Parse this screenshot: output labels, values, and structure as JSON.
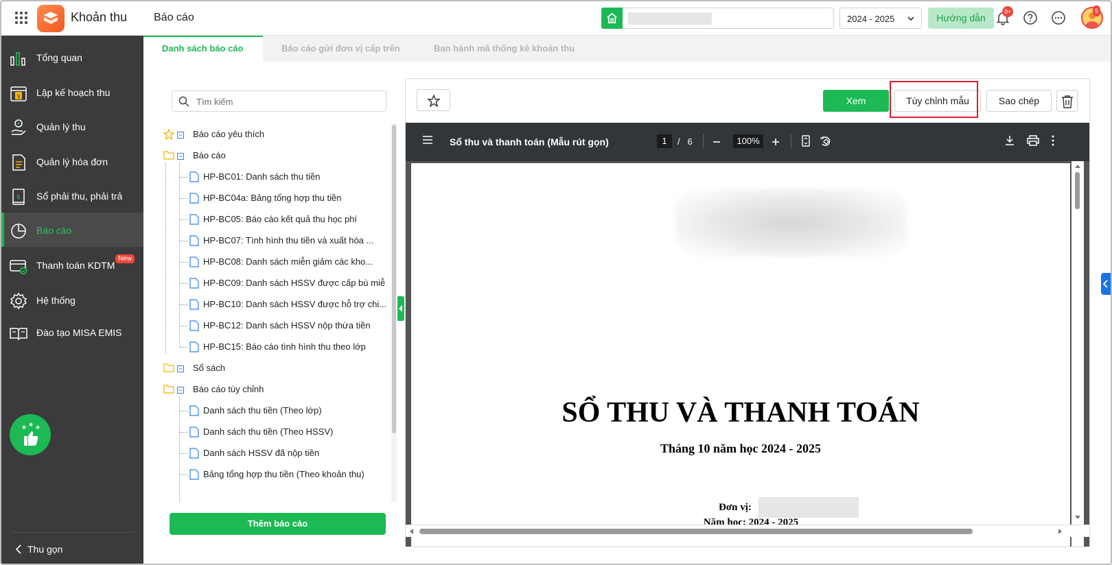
{
  "header": {
    "app_name": "Khoản thu",
    "page_title": "Báo cáo",
    "school_year": "2024 - 2025",
    "guide_label": "Hướng dẫn",
    "notif_badge": "9+",
    "avatar_badge": "5"
  },
  "sidebar": {
    "items": [
      {
        "label": "Tổng quan",
        "icon": "bar-chart-icon"
      },
      {
        "label": "Lập kế hoạch thu",
        "icon": "calendar-money-icon"
      },
      {
        "label": "Quản lý thu",
        "icon": "hand-coin-icon"
      },
      {
        "label": "Quản lý hóa đơn",
        "icon": "invoice-icon"
      },
      {
        "label": "Sổ phải thu, phải trả",
        "icon": "ledger-icon"
      },
      {
        "label": "Báo cáo",
        "icon": "pie-chart-icon"
      },
      {
        "label": "Thanh toán KDTM",
        "icon": "card-payment-icon"
      },
      {
        "label": "Hệ thống",
        "icon": "gear-icon"
      },
      {
        "label": "Đào tạo MISA EMIS",
        "icon": "book-icon"
      }
    ],
    "active_index": 5,
    "new_badge": "New",
    "collapse_label": "Thu gọn"
  },
  "tabs": [
    {
      "label": "Danh sách báo cáo",
      "active": true
    },
    {
      "label": "Báo cáo gửi đơn vị cấp trên",
      "active": false
    },
    {
      "label": "Ban hành mã thống kê khoản thu",
      "active": false
    }
  ],
  "search": {
    "placeholder": "Tìm kiếm"
  },
  "tree": {
    "favorites": "Báo cáo yêu thích",
    "reports_group": "Báo cáo",
    "reports": [
      "HP-BC01: Danh sách thu tiền",
      "HP-BC04a: Bảng tổng hợp thu tiền",
      "HP-BC05: Báo cáo kết quả thu học phí",
      "HP-BC07: Tình hình thu tiền và xuất hóa ...",
      "HP-BC08: Danh sách miễn giảm các kho...",
      "HP-BC09: Danh sách HSSV được cấp bù miễ",
      "HP-BC10: Danh sách HSSV được hỗ trợ chi...",
      "HP-BC12: Danh sách HSSV nộp thừa tiền",
      "HP-BC15: Báo cáo tình hình thu theo lớp"
    ],
    "books_group": "Sổ sách",
    "custom_group": "Báo cáo tùy chỉnh",
    "custom": [
      "Danh sách thu tiền (Theo lớp)",
      "Danh sách thu tiền (Theo HSSV)",
      "Danh sách HSSV đã nộp tiền",
      "Bảng tổng hợp thu tiền (Theo khoản thu)"
    ]
  },
  "add_report_label": "Thêm báo cáo",
  "toolbar": {
    "view_label": "Xem",
    "customize_label": "Tùy chỉnh mẫu",
    "copy_label": "Sao chép"
  },
  "pdf": {
    "title": "Sổ thu và thanh toán (Mẫu rút gọn)",
    "page": "1",
    "page_sep": "/",
    "total_pages": "6",
    "zoom": "100%"
  },
  "document": {
    "title": "SỔ THU VÀ THANH TOÁN",
    "subtitle": "Tháng 10 năm học 2024 - 2025",
    "unit_label": "Đơn vị:",
    "year_line": "Năm học: 2024 - 2025"
  },
  "colors": {
    "accent": "#1db954",
    "sidebar_bg": "#3b3b3b",
    "highlight": "#e0182d"
  }
}
